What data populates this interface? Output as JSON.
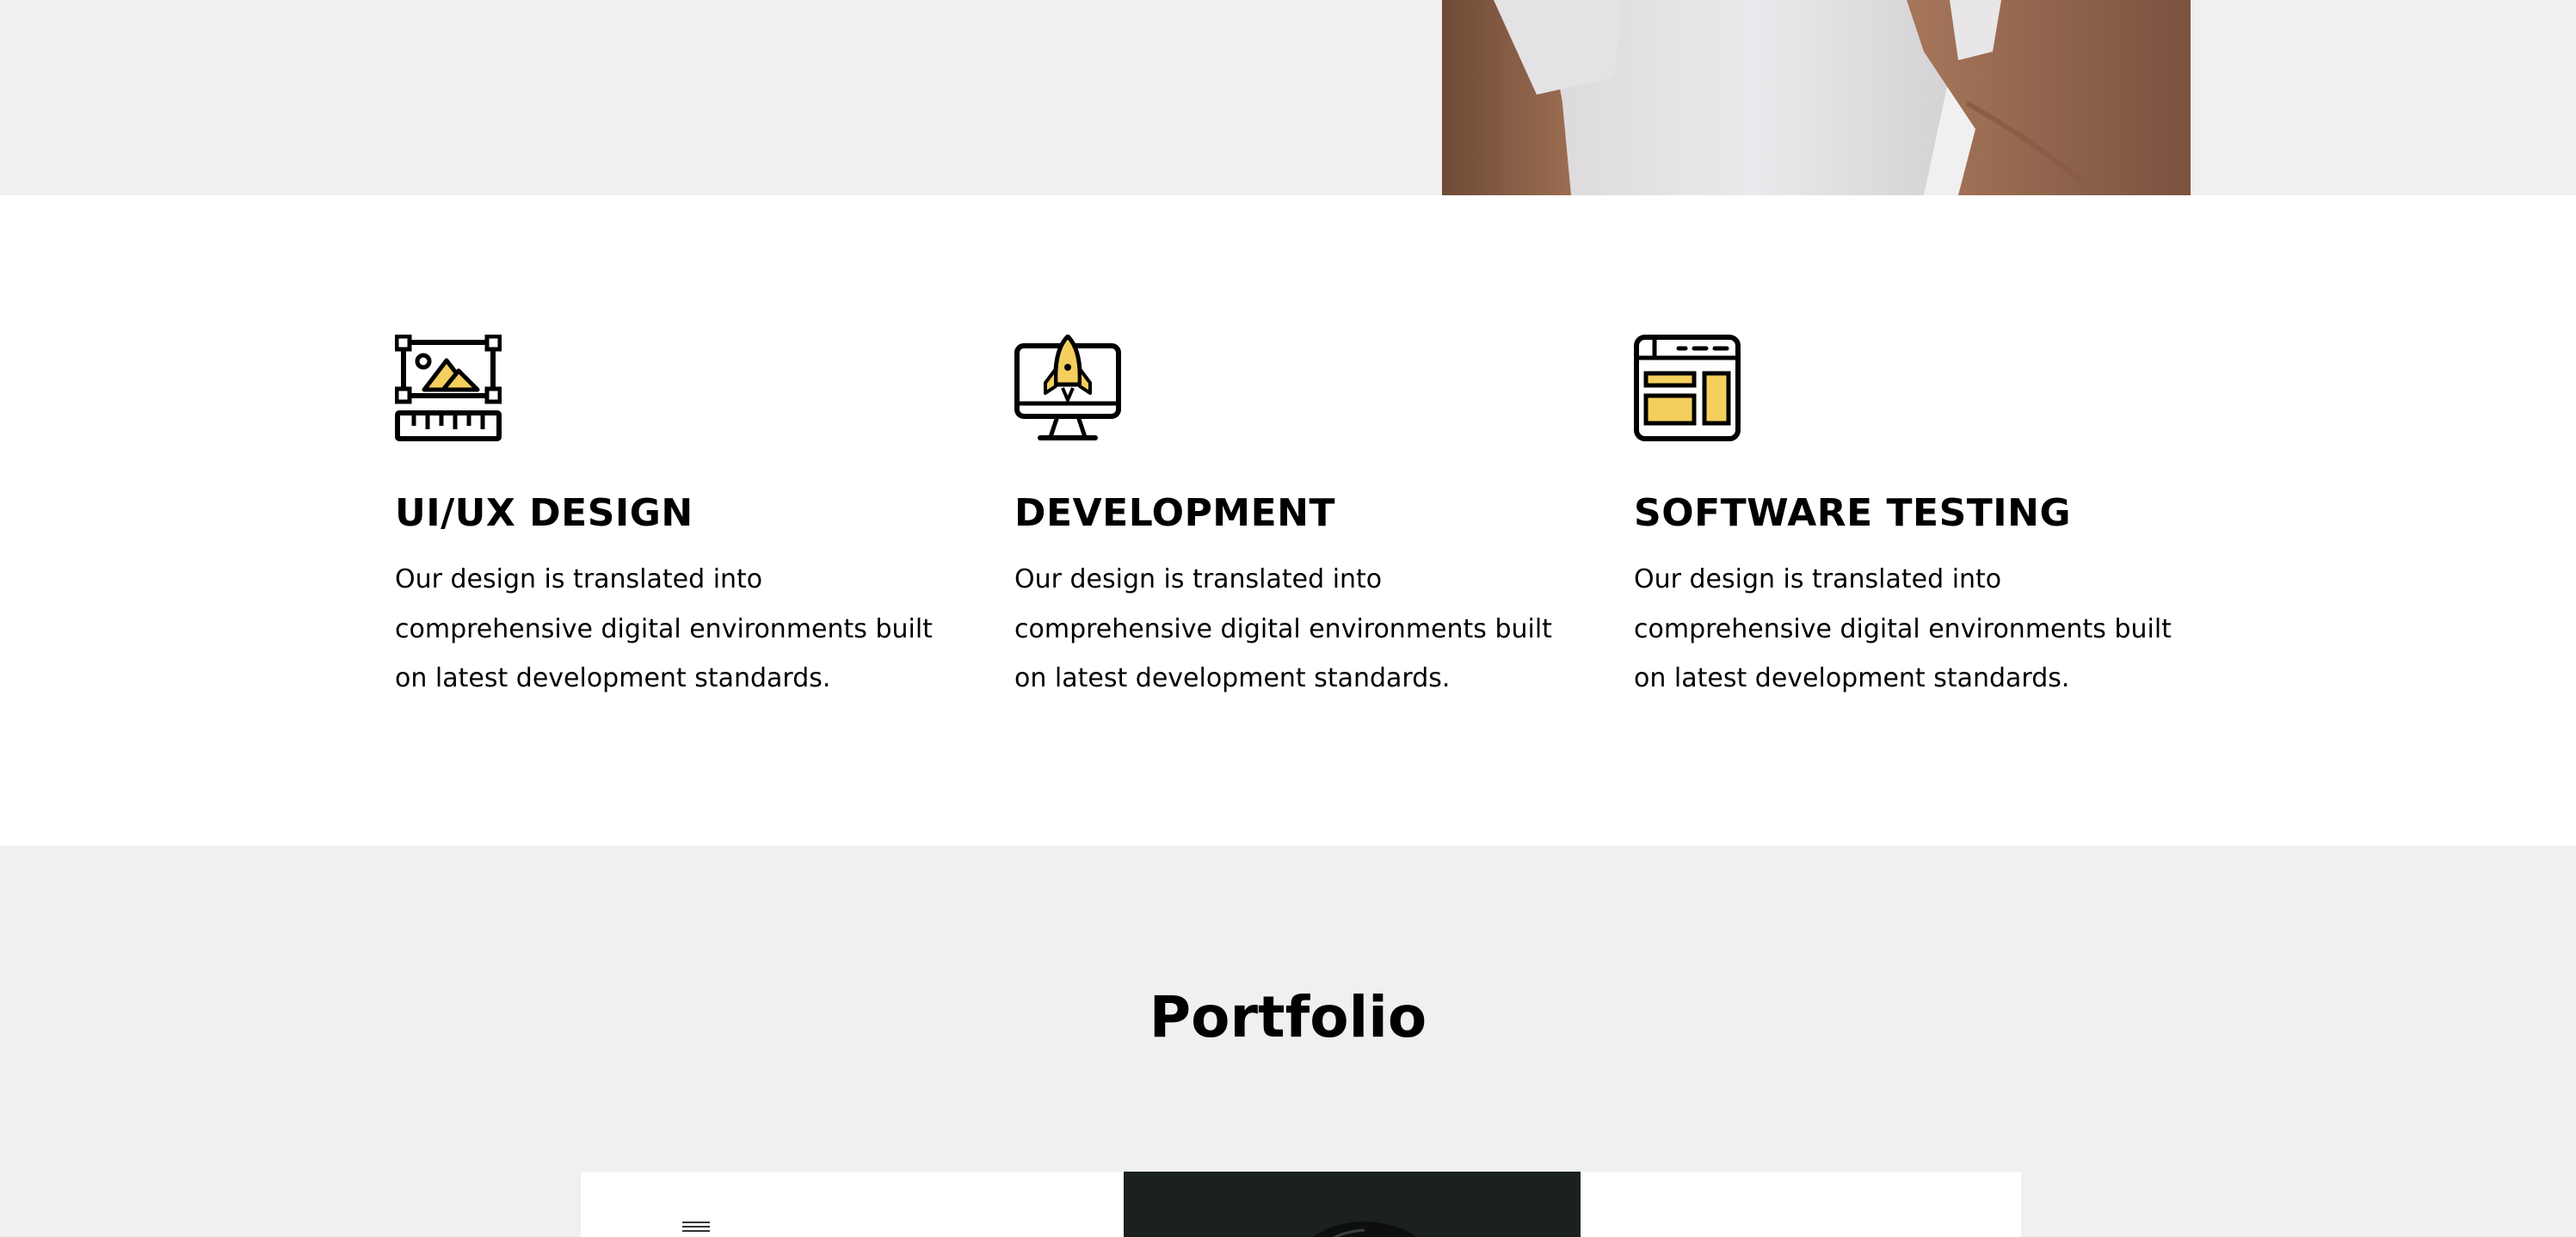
{
  "services": [
    {
      "title": "UI/UX DESIGN",
      "description": "Our design is translated into comprehensive digital environments built on latest development standards.",
      "icon": "design-frame-ruler-icon"
    },
    {
      "title": "DEVELOPMENT",
      "description": "Our design is translated into comprehensive digital environments built on latest development standards.",
      "icon": "monitor-rocket-icon"
    },
    {
      "title": "SOFTWARE TESTING",
      "description": "Our design is translated into comprehensive digital environments built on latest development standards.",
      "icon": "browser-layout-icon"
    }
  ],
  "portfolio": {
    "title": "Portfolio",
    "menu_icon": "hamburger-menu-icon"
  },
  "colors": {
    "accent": "#f5cf5d",
    "section_gray": "#f0f0f0",
    "section_white": "#ffffff",
    "text": "#000000"
  }
}
